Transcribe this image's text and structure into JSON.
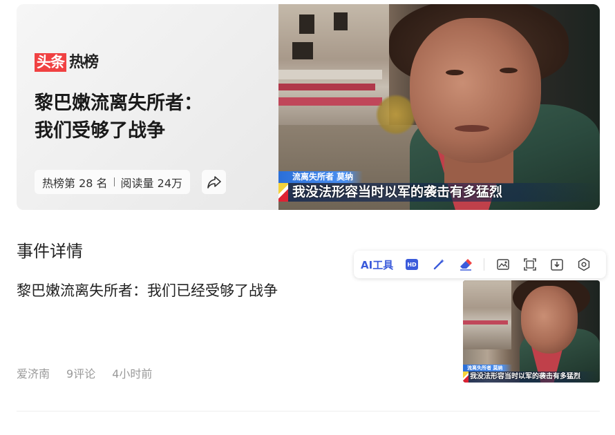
{
  "hero": {
    "brand_red": "头条",
    "brand_black": "热榜",
    "title_line1": "黎巴嫩流离失所者：",
    "title_line2": "我们受够了战争",
    "rank": "热榜第 28 名",
    "reads": "阅读量 24万",
    "share_icon": "share-icon",
    "image": {
      "subtitle_name": "流离失所者 莫纳",
      "subtitle_text": "我没法形容当时以军的袭击有多猛烈"
    }
  },
  "details": {
    "section_title": "事件详情",
    "summary": "黎巴嫩流离失所者：我们已经受够了战争",
    "meta": {
      "source": "爱济南",
      "comments": "9评论",
      "time": "4小时前"
    },
    "thumbnail": {
      "subtitle_name": "流离失所者 莫纳",
      "subtitle_text": "我没法形容当时以军的袭击有多猛烈"
    }
  },
  "toolbar": {
    "ai_label": "AI工具",
    "icons": [
      "hd-icon",
      "magic-wand-icon",
      "eraser-icon",
      "image-edit-icon",
      "crop-icon",
      "download-icon",
      "settings-icon"
    ]
  },
  "colors": {
    "brand_red": "#f04142",
    "accent_blue": "#3b5bdb",
    "meta_gray": "#999999"
  }
}
